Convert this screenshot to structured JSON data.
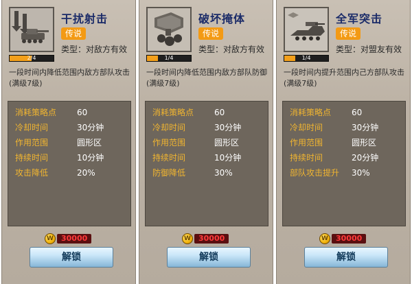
{
  "cards": [
    {
      "title": "干扰射击",
      "rarity": "传说",
      "type": "类型：对敌方有效",
      "level_text": "2/4",
      "level_fill": 0.5,
      "desc": "一段时间内降低范围内敌方部队攻击(满级7级)",
      "stats": [
        {
          "label": "消耗策略点",
          "value": "60"
        },
        {
          "label": "冷却时间",
          "value": "30分钟"
        },
        {
          "label": "作用范围",
          "value": "圆形区"
        },
        {
          "label": "持续时间",
          "value": "10分钟"
        },
        {
          "label": "攻击降低",
          "value": "20%"
        }
      ],
      "cost": "30000",
      "button_label": "解锁",
      "icon": "artillery-strike-icon"
    },
    {
      "title": "破坏掩体",
      "rarity": "传说",
      "type": "类型：对敌方有效",
      "level_text": "1/4",
      "level_fill": 0.25,
      "desc": "一段时间内降低范围内敌方部队防御(满级7级)",
      "stats": [
        {
          "label": "消耗策略点",
          "value": "60"
        },
        {
          "label": "冷却时间",
          "value": "30分钟"
        },
        {
          "label": "作用范围",
          "value": "圆形区"
        },
        {
          "label": "持续时间",
          "value": "10分钟"
        },
        {
          "label": "防御降低",
          "value": "30%"
        }
      ],
      "cost": "30000",
      "button_label": "解锁",
      "icon": "bunker-buster-icon"
    },
    {
      "title": "全军突击",
      "rarity": "传说",
      "type": "类型：对盟友有效",
      "level_text": "1/4",
      "level_fill": 0.25,
      "desc": "一段时间内提升范围内己方部队攻击(满级7级)",
      "stats": [
        {
          "label": "消耗策略点",
          "value": "60"
        },
        {
          "label": "冷却时间",
          "value": "30分钟"
        },
        {
          "label": "作用范围",
          "value": "圆形区"
        },
        {
          "label": "持续时间",
          "value": "20分钟"
        },
        {
          "label": "部队攻击提升",
          "value": "30%"
        }
      ],
      "cost": "30000",
      "button_label": "解锁",
      "icon": "full-assault-icon"
    }
  ],
  "coin_symbol": "W",
  "colors": {
    "title": "#1b2b68",
    "badge": "#f39a14",
    "stat_label": "#f1b530",
    "cost_text": "#ff3a3a"
  }
}
